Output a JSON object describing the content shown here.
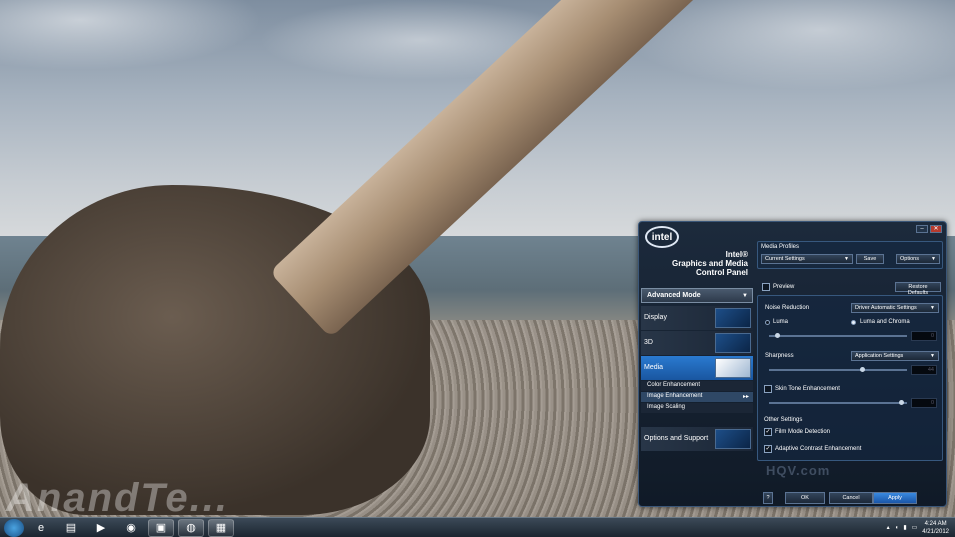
{
  "desktop": {
    "watermark": "AnandTe..."
  },
  "taskbar": {
    "apps": [
      {
        "name": "ie-icon",
        "glyph": "e"
      },
      {
        "name": "explorer-icon",
        "glyph": "▤"
      },
      {
        "name": "media-player-icon",
        "glyph": "▶"
      },
      {
        "name": "firefox-icon",
        "glyph": "◉"
      },
      {
        "name": "app-icon-1",
        "glyph": "▣"
      },
      {
        "name": "app-icon-2",
        "glyph": "◍"
      },
      {
        "name": "intel-panel-icon",
        "glyph": "▦"
      }
    ],
    "clock_time": "4:24 AM",
    "clock_date": "4/21/2012"
  },
  "panel": {
    "logo": "intel",
    "brand_line1": "Intel®",
    "brand_line2": "Graphics and Media",
    "brand_line3": "Control Panel",
    "mode": "Advanced Mode",
    "nav": [
      "Display",
      "3D",
      "Media",
      "Options and Support"
    ],
    "media_sub": [
      "Color Enhancement",
      "Image Enhancement",
      "Image Scaling"
    ],
    "profiles_label": "Media Profiles",
    "profile_value": "Current Settings",
    "save": "Save",
    "options": "Options",
    "preview": "Preview",
    "restore": "Restore Defaults",
    "noise_label": "Noise Reduction",
    "noise_value": "Driver Automatic Settings",
    "luma": "Luma",
    "luma_chroma": "Luma and Chroma",
    "noise_num": "0",
    "sharpness_label": "Sharpness",
    "sharpness_value": "Application Settings",
    "sharpness_num": "44",
    "skin_tone": "Skin Tone Enhancement",
    "skin_num": "0",
    "other_settings": "Other Settings",
    "film_mode": "Film Mode Detection",
    "adaptive_contrast": "Adaptive Contrast Enhancement",
    "hqv": "HQV.com",
    "help": "?",
    "ok": "OK",
    "cancel": "Cancel",
    "apply": "Apply"
  }
}
